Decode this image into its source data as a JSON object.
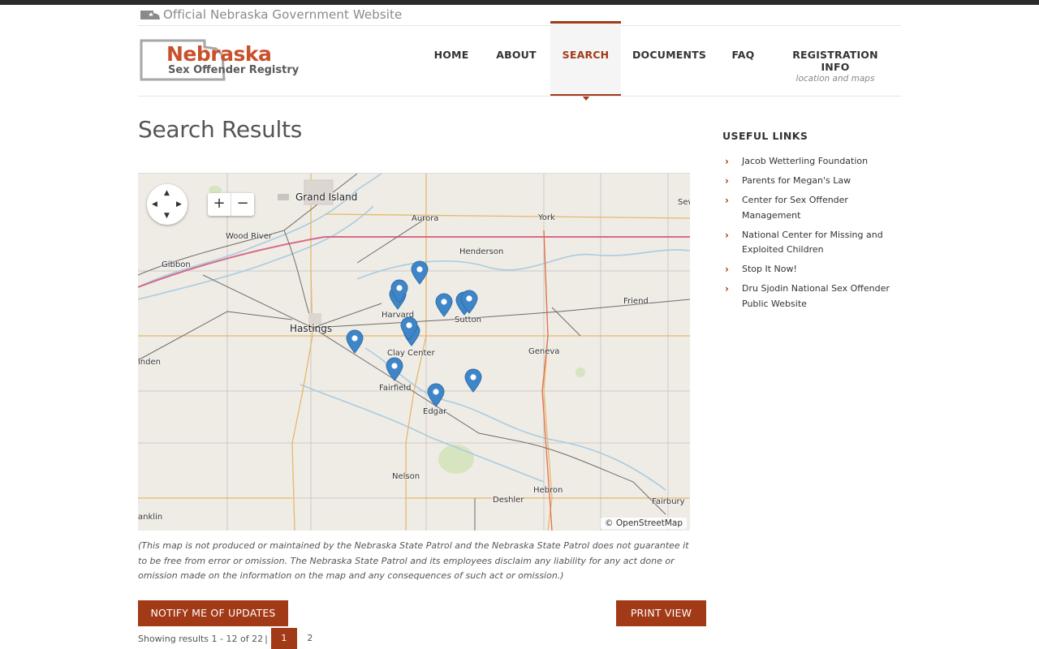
{
  "header": {
    "official_text": "Official Nebraska Government Website",
    "logo_title": "Nebraska",
    "logo_subtitle": "Sex Offender Registry"
  },
  "nav": {
    "items": [
      {
        "label": "HOME"
      },
      {
        "label": "ABOUT"
      },
      {
        "label": "SEARCH",
        "active": true
      },
      {
        "label": "DOCUMENTS"
      },
      {
        "label": "FAQ"
      },
      {
        "label": "REGISTRATION INFO",
        "sub": "location and maps"
      }
    ]
  },
  "page": {
    "title": "Search Results"
  },
  "map": {
    "zoom_in": "+",
    "zoom_out": "−",
    "attribution": "© OpenStreetMap",
    "places": [
      "Grand Island",
      "Aurora",
      "York",
      "Sew",
      "Wood River",
      "Henderson",
      "Gibbon",
      "Friend",
      "Harvard",
      "Sutton",
      "Hastings",
      "Clay Center",
      "Geneva",
      "inden",
      "Fairfield",
      "Edgar",
      "Nelson",
      "Hebron",
      "Deshler",
      "Fairbury",
      "anklin"
    ],
    "marker_count": 12,
    "pin_color": "#3f86c8"
  },
  "disclaimer": "(This map is not produced or maintained by the Nebraska State Patrol and the Nebraska State Patrol does not guarantee it to be free from error or omission. The Nebraska State Patrol and its employees disclaim any liability for any act done or omission made on the information on the map and any consequences of such act or omission.)",
  "buttons": {
    "notify": "NOTIFY ME OF UPDATES",
    "print": "PRINT VIEW"
  },
  "pagination": {
    "info": "Showing results 1 - 12 of 22",
    "separator": "|",
    "pages": [
      "1",
      "2"
    ],
    "current": "1"
  },
  "sidebar": {
    "title": "USEFUL LINKS",
    "links": [
      "Jacob Wetterling Foundation",
      "Parents for Megan's Law",
      "Center for Sex Offender Management",
      "National Center for Missing and Exploited Children",
      "Stop It Now!",
      "Dru Sjodin National Sex Offender Public Website"
    ]
  },
  "colors": {
    "accent": "#a33a17",
    "logo_orange": "#c8502a",
    "map_pin": "#3f86c8"
  }
}
